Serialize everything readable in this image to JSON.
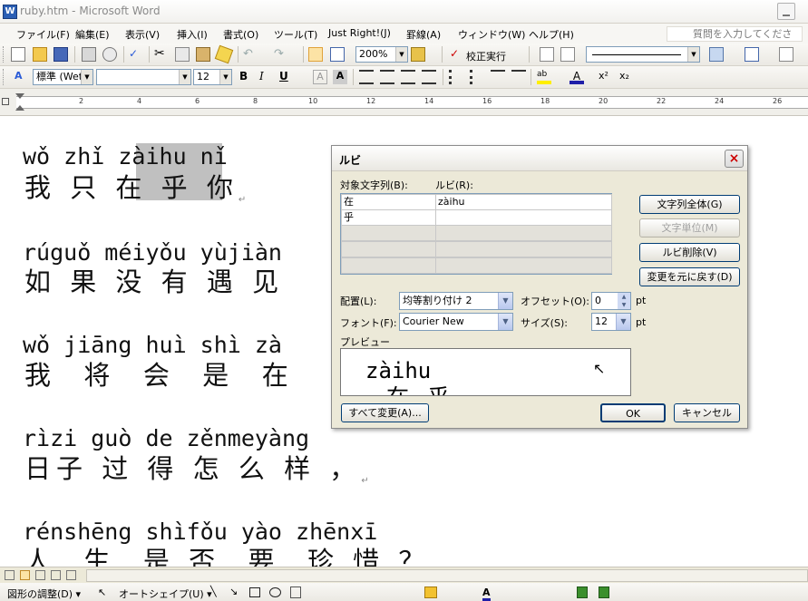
{
  "window": {
    "title": "ruby.htm - Microsoft Word",
    "app_icon": "W"
  },
  "menu": {
    "items": [
      "ファイル(F)",
      "編集(E)",
      "表示(V)",
      "挿入(I)",
      "書式(O)",
      "ツール(T)",
      "Just Right!(J)",
      "罫線(A)",
      "ウィンドウ(W)",
      "ヘルプ(H)"
    ],
    "help_placeholder": "質問を入力してください"
  },
  "toolbar": {
    "zoom": "200%",
    "proofread_label": "校正実行"
  },
  "format": {
    "style": "標準 (Wet",
    "font_name": "",
    "font_size": "12"
  },
  "ruler": {
    "numbers": [
      "2",
      "4",
      "6",
      "8",
      "10",
      "12",
      "14",
      "16",
      "18",
      "20",
      "22",
      "24",
      "26"
    ]
  },
  "document": {
    "lines": [
      {
        "pinyin": "wǒ zhǐ zàihu nǐ",
        "hanzi": "我 只 在 乎 你",
        "mark": "↵"
      },
      {
        "pinyin": "rúguǒ méiyǒu yùjiàn",
        "hanzi": "如 果 没 有 遇 见",
        "mark": ""
      },
      {
        "pinyin": "wǒ jiāng huì shì zà",
        "hanzi": "我  将  会  是  在",
        "mark": ""
      },
      {
        "pinyin": "rìzi guò de zěnmeyàng",
        "hanzi": "日子 过 得 怎 么 样 ，",
        "mark": "↵"
      },
      {
        "pinyin": "rénshēng shìfǒu yào zhēnxī",
        "hanzi": "人  生  是 否  要  珍 惜 ？",
        "mark": "↵"
      }
    ]
  },
  "drawbar": {
    "draw_label": "図形の調整(D) ▾",
    "autoshape_label": "オートシェイプ(U) ▾"
  },
  "dialog": {
    "title": "ルビ",
    "close": "×",
    "base_text_label": "対象文字列(B):",
    "ruby_label": "ルビ(R):",
    "rows": [
      {
        "base": "在",
        "ruby": "zàihu"
      },
      {
        "base": "乎",
        "ruby": ""
      },
      {
        "base": "",
        "ruby": ""
      },
      {
        "base": "",
        "ruby": ""
      },
      {
        "base": "",
        "ruby": ""
      }
    ],
    "buttons": {
      "whole": "文字列全体(G)",
      "char_unit": "文字単位(M)",
      "delete_ruby": "ルビ削除(V)",
      "reset": "変更を元に戻す(D)",
      "apply_all": "すべて変更(A)...",
      "ok": "OK",
      "cancel": "キャンセル"
    },
    "alignment_label": "配置(L):",
    "alignment_value": "均等割り付け 2",
    "offset_label": "オフセット(O):",
    "offset_value": "0",
    "font_label": "フォント(F):",
    "font_value": "Courier New",
    "size_label": "サイズ(S):",
    "size_value": "12",
    "unit": "pt",
    "preview_label": "プレビュー",
    "preview_ruby": "zàihu",
    "preview_base": "在乎"
  }
}
